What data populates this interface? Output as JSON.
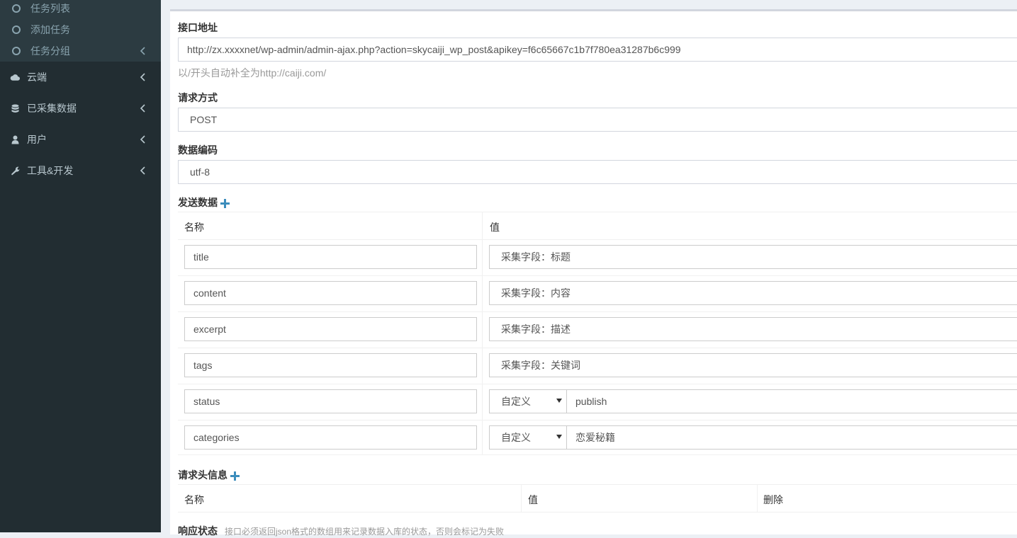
{
  "sidebar": {
    "sub_items": [
      {
        "label": "任务列表"
      },
      {
        "label": "添加任务"
      },
      {
        "label": "任务分组"
      }
    ],
    "items": [
      {
        "label": "云端",
        "icon": "cloud-icon"
      },
      {
        "label": "已采集数据",
        "icon": "database-icon"
      },
      {
        "label": "用户",
        "icon": "user-icon"
      },
      {
        "label": "工具&开发",
        "icon": "wrench-icon"
      }
    ],
    "colors": {
      "bg": "#222d32",
      "sub_bg": "#2c3b41",
      "text": "#b8c7ce"
    }
  },
  "form": {
    "api_url": {
      "label": "接口地址",
      "value": "http://zx.xxxxnet/wp-admin/admin-ajax.php?action=skycaiji_wp_post&apikey=f6c65667c1b7f780ea31287b6c999",
      "help": "以/开头自动补全为http://caiji.com/"
    },
    "method": {
      "label": "请求方式",
      "value": "POST"
    },
    "charset": {
      "label": "数据编码",
      "value": "utf-8"
    },
    "post_data": {
      "label": "发送数据",
      "col_name": "名称",
      "col_value": "值",
      "rows": [
        {
          "name": "title",
          "value": "采集字段：标题"
        },
        {
          "name": "content",
          "value": "采集字段：内容"
        },
        {
          "name": "excerpt",
          "value": "采集字段：描述"
        },
        {
          "name": "tags",
          "value": "采集字段：关键词"
        },
        {
          "name": "status",
          "type": "自定义",
          "value": "publish"
        },
        {
          "name": "categories",
          "type": "自定义",
          "value": "恋爱秘籍"
        }
      ]
    },
    "headers": {
      "label": "请求头信息",
      "col_name": "名称",
      "col_value": "值",
      "col_delete": "删除"
    },
    "response": {
      "label": "响应状态",
      "help": "接口必须返回json格式的数组用来记录数据入库的状态，否则会标记为失败"
    }
  }
}
